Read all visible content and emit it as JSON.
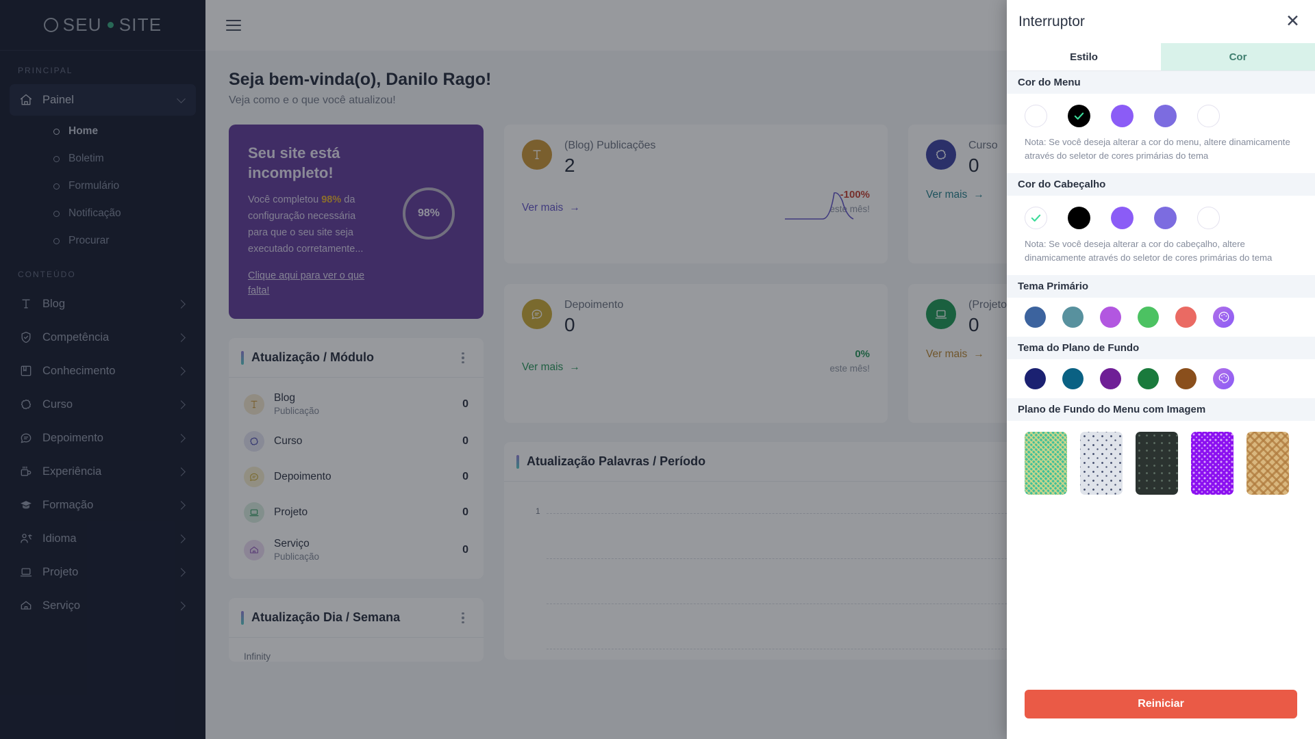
{
  "sidebar": {
    "logo": {
      "text_a": "SEU",
      "text_b": "SITE"
    },
    "sections": [
      {
        "label": "PRINCIPAL"
      },
      {
        "label": "CONTEÚDO"
      }
    ],
    "principal": {
      "item": {
        "label": "Painel",
        "icon": "home-icon"
      },
      "subitems": [
        {
          "label": "Home",
          "active": true
        },
        {
          "label": "Boletim",
          "active": false
        },
        {
          "label": "Formulário",
          "active": false
        },
        {
          "label": "Notificação",
          "active": false
        },
        {
          "label": "Procurar",
          "active": false
        }
      ]
    },
    "conteudo": [
      {
        "label": "Blog",
        "icon": "text-t-icon"
      },
      {
        "label": "Competência",
        "icon": "shield-check-icon"
      },
      {
        "label": "Conhecimento",
        "icon": "book-icon"
      },
      {
        "label": "Curso",
        "icon": "gear-badge-icon"
      },
      {
        "label": "Depoimento",
        "icon": "chat-bubble-icon"
      },
      {
        "label": "Experiência",
        "icon": "mug-icon"
      },
      {
        "label": "Formação",
        "icon": "graduation-cap-icon"
      },
      {
        "label": "Idioma",
        "icon": "language-icon"
      },
      {
        "label": "Projeto",
        "icon": "laptop-icon"
      },
      {
        "label": "Serviço",
        "icon": "service-icon"
      }
    ]
  },
  "main": {
    "welcome_title": "Seja bem-vinda(o), Danilo Rago!",
    "welcome_subtitle": "Veja como e o que você atualizou!",
    "promo": {
      "heading": "Seu site está incompleto!",
      "body_pre": "Você completou ",
      "body_pct": "98%",
      "body_post": " da configuração necessária para que o seu site seja executado corretamente...",
      "link": "Clique aqui para ver o que falta!",
      "ring_value": "98%"
    },
    "modules_panel": {
      "title": "Atualização / Módulo",
      "rows": [
        {
          "name": "Blog",
          "sub": "Publicação",
          "value": "0",
          "icon": "text-t-icon",
          "color": "#c9912e"
        },
        {
          "name": "Curso",
          "sub": "",
          "value": "0",
          "icon": "gear-badge-icon",
          "color": "#3f3fa8"
        },
        {
          "name": "Depoimento",
          "sub": "",
          "value": "0",
          "icon": "chat-bubble-icon",
          "color": "#c9a72e"
        },
        {
          "name": "Projeto",
          "sub": "",
          "value": "0",
          "icon": "laptop-icon",
          "color": "#1f9254"
        },
        {
          "name": "Serviço",
          "sub": "Publicação",
          "value": "0",
          "icon": "service-icon",
          "color": "#8a4fb5"
        }
      ]
    },
    "week_panel": {
      "title": "Atualização Dia / Semana",
      "axis_label": "Infinity"
    },
    "stats": [
      {
        "label": "(Blog) Publicações",
        "value": "2",
        "icon": "text-t-icon",
        "color": "#c9912e",
        "link": "Ver mais",
        "pct": "-100%",
        "pct_color": "#c0392b",
        "period": "este mês!",
        "link_color": "#5b4cc4"
      },
      {
        "label": "Curso",
        "value": "0",
        "icon": "gear-badge-icon",
        "color": "#333a9e",
        "link": "Ver mais",
        "pct": "",
        "pct_color": "#2e7d7d",
        "period": "",
        "link_color": "#1c7a86"
      },
      {
        "label": "Depoimento",
        "value": "0",
        "icon": "chat-bubble-icon",
        "color": "#c9a72e",
        "link": "Ver mais",
        "pct": "0%",
        "pct_color": "#1f9254",
        "period": "este mês!",
        "link_color": "#1f9254"
      },
      {
        "label": "(Projeto) Publicações",
        "value": "0",
        "icon": "laptop-icon",
        "color": "#14934f",
        "link": "Ver mais",
        "pct": "",
        "pct_color": "#b5802a",
        "period": "",
        "link_color": "#b5802a"
      }
    ],
    "words_panel": {
      "title": "Atualização Palavras / Período",
      "y_tick": "1"
    }
  },
  "switcher": {
    "title": "Interruptor",
    "close_icon": "close-icon",
    "tabs": [
      {
        "label": "Estilo",
        "selected": true
      },
      {
        "label": "Cor",
        "selected": false
      }
    ],
    "sections": [
      {
        "heading": "Cor do Menu",
        "swatches": [
          {
            "color": "#ffffff",
            "selected": false,
            "outline": true
          },
          {
            "color": "#000000",
            "selected": true,
            "outline": false
          },
          {
            "color": "#8b5cf6",
            "selected": false,
            "outline": false
          },
          {
            "color": "#7c6ce0",
            "selected": false,
            "outline": false
          },
          {
            "color": "#ffffff",
            "selected": false,
            "outline": true
          }
        ],
        "note": "Nota: Se você deseja alterar a cor do menu, altere dinamicamente através do seletor de cores primárias do tema"
      },
      {
        "heading": "Cor do Cabeçalho",
        "swatches": [
          {
            "color": "#ffffff",
            "selected": true,
            "outline": true
          },
          {
            "color": "#000000",
            "selected": false,
            "outline": false
          },
          {
            "color": "#8b5cf6",
            "selected": false,
            "outline": false
          },
          {
            "color": "#7c6ce0",
            "selected": false,
            "outline": false
          },
          {
            "color": "#ffffff",
            "selected": false,
            "outline": true
          }
        ],
        "note": "Nota: Se você deseja alterar a cor do cabeçalho, altere dinamicamente através do seletor de cores primárias do tema"
      }
    ],
    "primary_theme": {
      "heading": "Tema Primário",
      "swatches": [
        "#3c639e",
        "#58919e",
        "#b257e0",
        "#4cc262",
        "#ea6a63"
      ],
      "picker_icon": "color-picker-icon"
    },
    "background_theme": {
      "heading": "Tema do Plano de Fundo",
      "swatches": [
        "#1b2171",
        "#0a6183",
        "#6f1f96",
        "#1a7a3c",
        "#8a4f1c"
      ],
      "picker_icon": "color-picker-icon"
    },
    "menu_bg_image": {
      "heading": "Plano de Fundo do Menu com Imagem",
      "thumbs": [
        {
          "name": "pattern-teal-weave",
          "base": "#3fbf9a",
          "alt": "#d8d88a"
        },
        {
          "name": "pattern-light-dots",
          "base": "#dfe3ea",
          "alt": "#4a5472"
        },
        {
          "name": "pattern-dark-dots",
          "base": "#2b3330",
          "alt": "#5a6a60"
        },
        {
          "name": "pattern-violet-dots",
          "base": "#8b10f0",
          "alt": "#c98bf5"
        },
        {
          "name": "pattern-tan-grid",
          "base": "#d9b77e",
          "alt": "#b07b3e"
        }
      ]
    },
    "reset_label": "Reiniciar"
  }
}
